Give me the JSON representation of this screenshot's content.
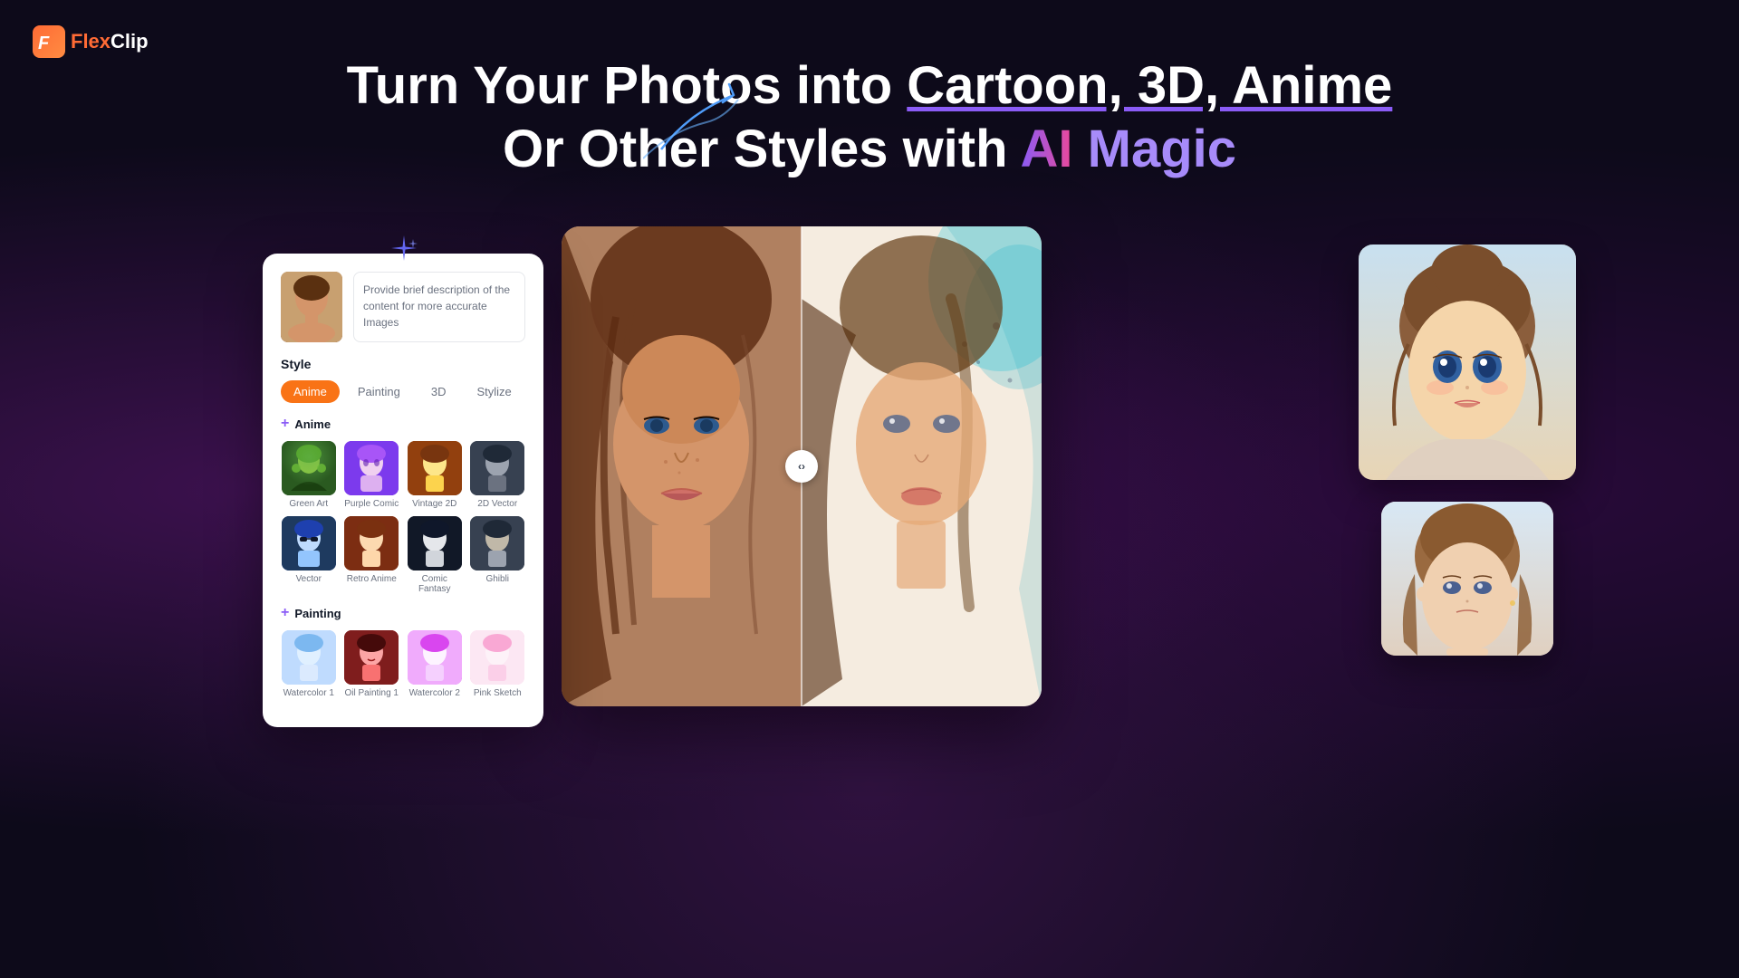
{
  "logo": {
    "icon_letter": "F",
    "text_plain": "lex",
    "brand": "Clip",
    "full": "FlexClip"
  },
  "header": {
    "title_line1": "Turn Your Photos into Cartoon, 3D, Anime",
    "title_line2": "Or Other Styles with ",
    "ai_magic": "AI Magic",
    "underlined_words": "Cartoon, 3D, Anime"
  },
  "panel": {
    "style_label": "Style",
    "description_placeholder": "Provide brief description of the content for more accurate Images",
    "tabs": [
      {
        "label": "Anime",
        "active": true
      },
      {
        "label": "Painting",
        "active": false
      },
      {
        "label": "3D",
        "active": false
      },
      {
        "label": "Stylize",
        "active": false
      }
    ],
    "anime_section": {
      "label": "Anime",
      "items": [
        {
          "name": "Green Art"
        },
        {
          "name": "Purple Comic"
        },
        {
          "name": "Vintage 2D"
        },
        {
          "name": "2D Vector"
        },
        {
          "name": "Vector"
        },
        {
          "name": "Retro Anime"
        },
        {
          "name": "Comic Fantasy"
        },
        {
          "name": "Ghibli"
        }
      ]
    },
    "painting_section": {
      "label": "Painting",
      "items": [
        {
          "name": "Watercolor 1"
        },
        {
          "name": "Oil Painting 1"
        },
        {
          "name": "Watercolor 2"
        },
        {
          "name": "Pink Sketch"
        }
      ]
    }
  },
  "slider": {
    "left_arrow": "‹",
    "right_arrow": "›",
    "arrows": "‹›"
  },
  "colors": {
    "accent_orange": "#f97316",
    "accent_purple": "#8b5cf6",
    "accent_pink": "#ec4899",
    "logo_orange": "#ff6b35"
  }
}
